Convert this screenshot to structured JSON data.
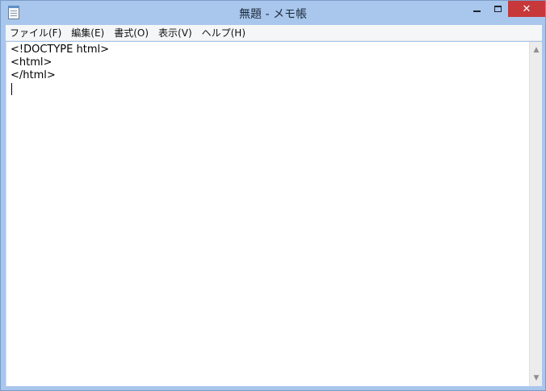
{
  "window": {
    "title": "無題 - メモ帳",
    "close_glyph": "✕"
  },
  "menu": {
    "items": [
      {
        "label": "ファイル(F)"
      },
      {
        "label": "編集(E)"
      },
      {
        "label": "書式(O)"
      },
      {
        "label": "表示(V)"
      },
      {
        "label": "ヘルプ(H)"
      }
    ]
  },
  "editor": {
    "lines": [
      "<!DOCTYPE html>",
      "<html>",
      "</html>",
      ""
    ]
  },
  "scrollbar": {
    "up_glyph": "▲",
    "down_glyph": "▼"
  },
  "icons": {
    "app": "notepad-icon",
    "minimize": "minimize-icon",
    "maximize": "maximize-icon",
    "close": "close-icon"
  },
  "colors": {
    "titlebar": "#a9c6ec",
    "close_button": "#c7383a",
    "menubar": "#f5f6f7",
    "editor_bg": "#ffffff"
  }
}
